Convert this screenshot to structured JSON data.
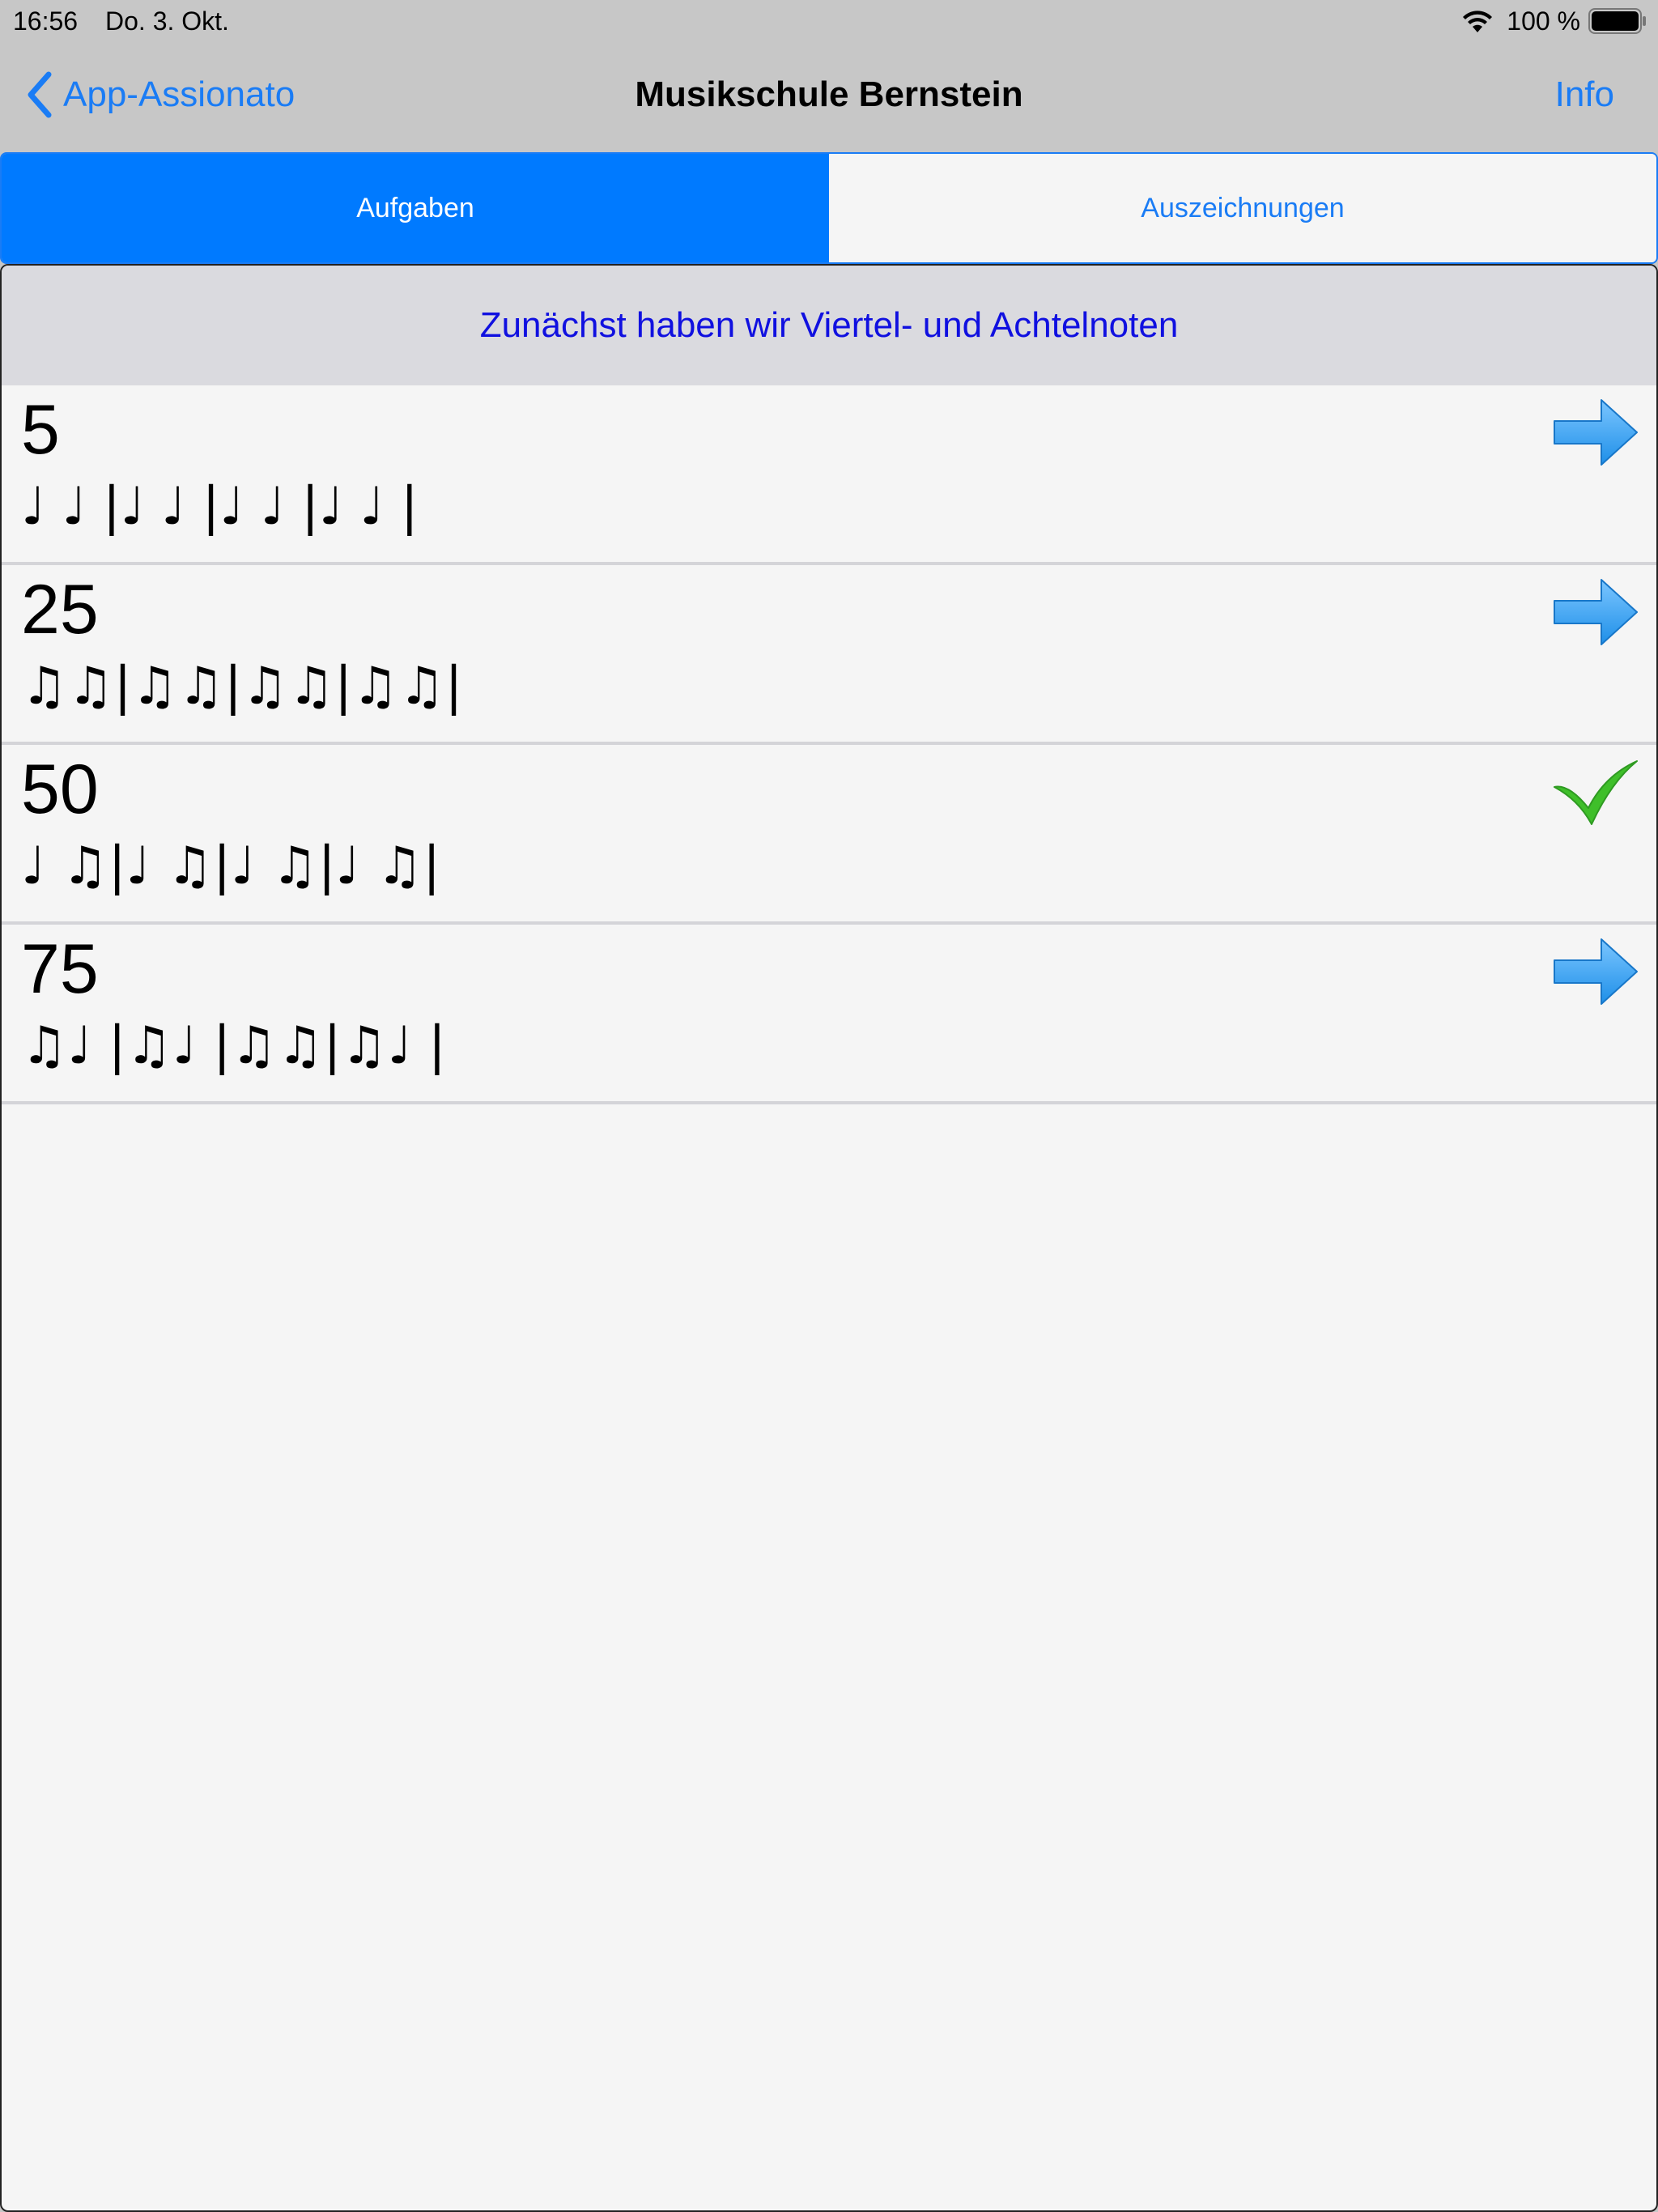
{
  "status_bar": {
    "time": "16:56",
    "date": "Do. 3. Okt.",
    "battery_percent": "100 %",
    "battery_level": 1.0
  },
  "nav": {
    "back_label": "App-Assionato",
    "title": "Musikschule Bernstein",
    "info_label": "Info"
  },
  "segments": [
    {
      "label": "Aufgaben",
      "selected": true
    },
    {
      "label": "Auszeichnungen",
      "selected": false
    }
  ],
  "section": {
    "header": "Zunächst haben wir Viertel- und Achtelnoten"
  },
  "tasks": [
    {
      "number": "5",
      "rhythm": "♩ ♩ |♩ ♩ |♩ ♩ |♩ ♩ |",
      "status": "arrow-right-icon"
    },
    {
      "number": "25",
      "rhythm": "♫♫|♫♫|♫♫|♫♫|",
      "status": "arrow-right-icon"
    },
    {
      "number": "50",
      "rhythm": "♩ ♫|♩ ♫|♩ ♫|♩ ♫|",
      "status": "checkmark-icon"
    },
    {
      "number": "75",
      "rhythm": "♫♩ |♫♩ |♫♫|♫♩ |",
      "status": "arrow-right-icon"
    }
  ],
  "colors": {
    "accent": "#007aff",
    "link": "#1a7cf5",
    "section_text": "#1010e0",
    "check": "#3fbf2a",
    "arrow": "#1e8fe8"
  }
}
